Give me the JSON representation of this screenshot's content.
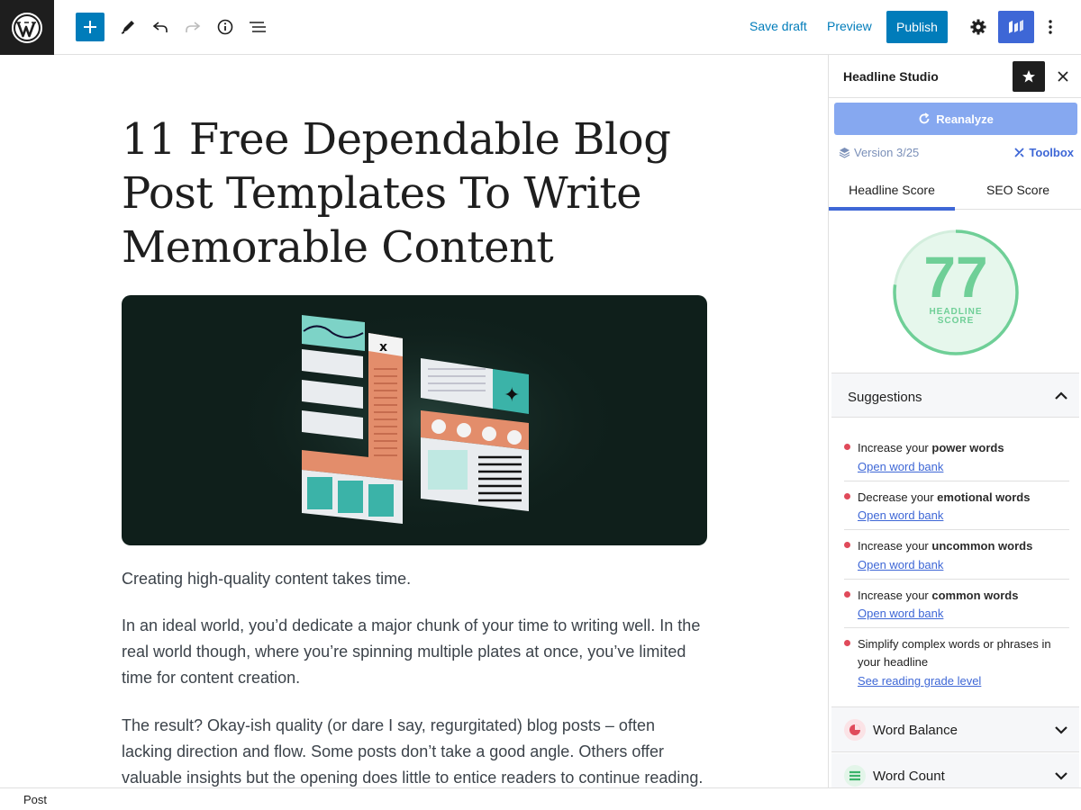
{
  "toolbar": {
    "save_draft": "Save draft",
    "preview": "Preview",
    "publish": "Publish",
    "accent": "#007cba"
  },
  "post": {
    "title": "11 Free Dependable Blog Post Templates To Write Memorable Content",
    "paragraphs": [
      "Creating high-quality content takes time.",
      "In an ideal world, you’d dedicate a major chunk of your time to writing well. In the real world though, where you’re spinning multiple plates at once, you’ve limited time for content creation.",
      "The result? Okay-ish quality (or dare I say, regurgitated) blog posts – often lacking direction and flow. Some posts don’t take a good angle. Others offer valuable insights but the opening does little to entice readers to continue reading."
    ]
  },
  "sidebar": {
    "title": "Headline Studio",
    "reanalyze": "Reanalyze",
    "version": "Version 3/25",
    "toolbox": "Toolbox",
    "tabs": [
      "Headline Score",
      "SEO Score"
    ],
    "score": {
      "value": "77",
      "label_line1": "HEADLINE",
      "label_line2": "SCORE",
      "fraction": 0.77,
      "color": "#6fcf97"
    },
    "suggestions": {
      "title": "Suggestions",
      "items": [
        {
          "prefix": "Increase your ",
          "bold": "power words",
          "link": "Open word bank"
        },
        {
          "prefix": "Decrease your ",
          "bold": "emotional words",
          "link": "Open word bank"
        },
        {
          "prefix": "Increase your ",
          "bold": "uncommon words",
          "link": "Open word bank"
        },
        {
          "prefix": "Increase your ",
          "bold": "common words",
          "link": "Open word bank"
        },
        {
          "prefix": "Simplify complex words or phrases in your headline",
          "bold": "",
          "link": "See reading grade level"
        }
      ]
    },
    "panels": [
      "Word Balance",
      "Word Count"
    ]
  },
  "footer": {
    "breadcrumb": "Post"
  }
}
